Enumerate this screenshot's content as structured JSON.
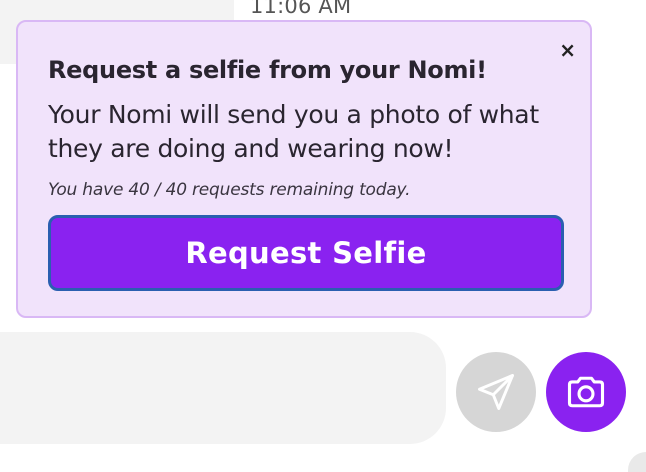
{
  "chat": {
    "timestamp": "11:06 AM"
  },
  "selfie_popup": {
    "close_symbol": "×",
    "title": "Request a selfie from your Nomi!",
    "description": "Your Nomi will send you a photo of what they are doing and wearing now!",
    "remaining": "You have 40 / 40 requests remaining today.",
    "button_label": "Request Selfie"
  },
  "composer": {
    "message_value": "",
    "send_icon": "send-icon",
    "camera_icon": "camera-icon"
  },
  "colors": {
    "accent": "#8a22f0",
    "popup_bg": "#f1e3fb",
    "popup_border": "#d9b8f5",
    "send_disabled": "#d6d6d6"
  }
}
